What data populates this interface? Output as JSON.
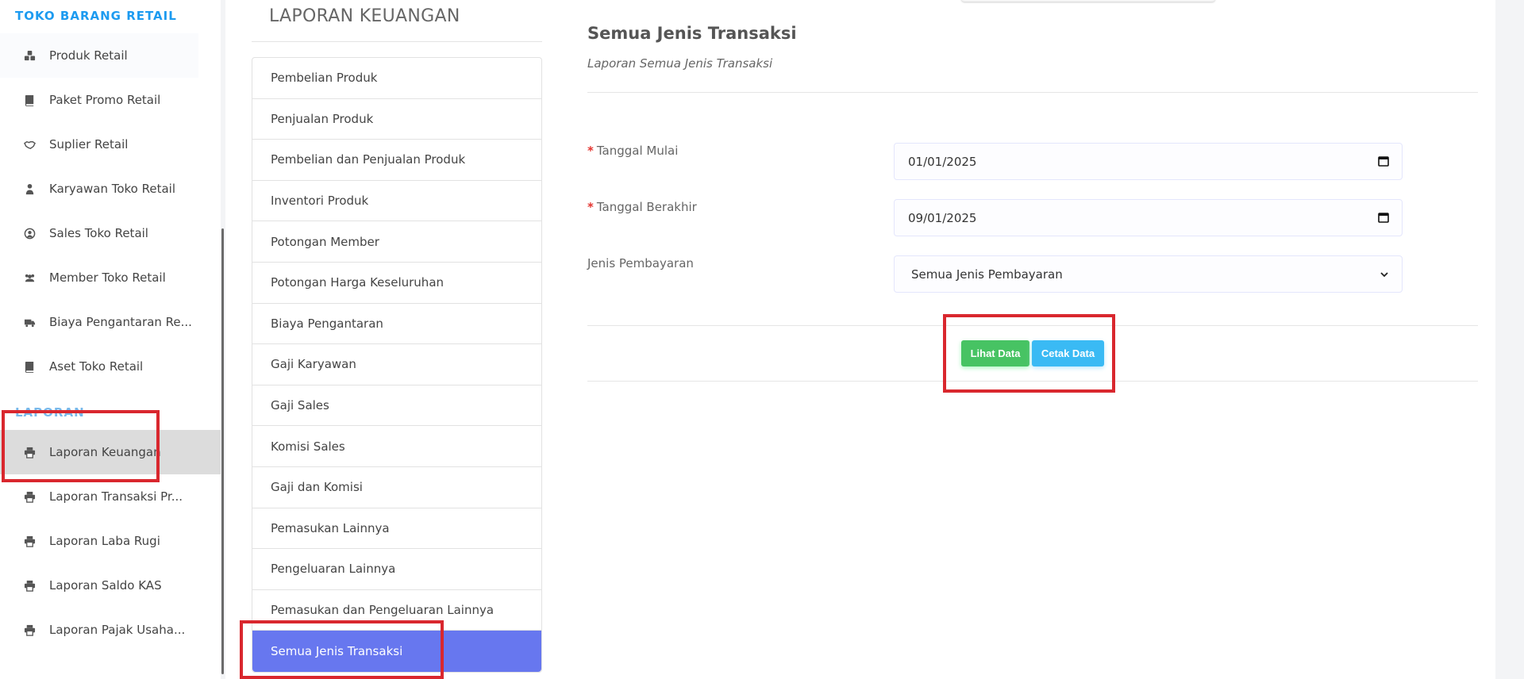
{
  "sidebar": {
    "section_store": "TOKO BARANG RETAIL",
    "items": [
      {
        "label": "Produk Retail",
        "icon": "boxes-icon"
      },
      {
        "label": "Paket Promo Retail",
        "icon": "book-icon"
      },
      {
        "label": "Suplier Retail",
        "icon": "handshake-icon"
      },
      {
        "label": "Karyawan Toko Retail",
        "icon": "user-tie-icon"
      },
      {
        "label": "Sales Toko Retail",
        "icon": "user-circle-icon"
      },
      {
        "label": "Member Toko Retail",
        "icon": "users-icon"
      },
      {
        "label": "Biaya Pengantaran Re...",
        "icon": "truck-icon"
      },
      {
        "label": "Aset Toko Retail",
        "icon": "book-icon"
      }
    ],
    "section_report": "LAPORAN",
    "report_items": [
      {
        "label": "Laporan Keuangan",
        "icon": "print-icon"
      },
      {
        "label": "Laporan Transaksi Pr...",
        "icon": "print-icon"
      },
      {
        "label": "Laporan Laba Rugi",
        "icon": "print-icon"
      },
      {
        "label": "Laporan Saldo KAS",
        "icon": "print-icon"
      },
      {
        "label": "Laporan Pajak Usaha...",
        "icon": "print-icon"
      }
    ]
  },
  "report_menu": {
    "title": "LAPORAN KEUANGAN",
    "items": [
      "Pembelian Produk",
      "Penjualan Produk",
      "Pembelian dan Penjualan Produk",
      "Inventori Produk",
      "Potongan Member",
      "Potongan Harga Keseluruhan",
      "Biaya Pengantaran",
      "Gaji Karyawan",
      "Gaji Sales",
      "Komisi Sales",
      "Gaji dan Komisi",
      "Pemasukan Lainnya",
      "Pengeluaran Lainnya",
      "Pemasukan dan Pengeluaran Lainnya",
      "Semua Jenis Transaksi"
    ]
  },
  "form": {
    "heading": "Semua Jenis Transaksi",
    "subheading": "Laporan Semua Jenis Transaksi",
    "required_mark": "*",
    "start_label": "Tanggal Mulai",
    "start_value": "01/01/2025",
    "end_label": "Tanggal Berakhir",
    "end_value": "09/01/2025",
    "payment_label": "Jenis Pembayaran",
    "payment_value": "Semua Jenis Pembayaran",
    "view_button": "Lihat Data",
    "print_button": "Cetak Data"
  },
  "colors": {
    "accent": "#6777ef",
    "sidebar_heading": "#1d9bf0",
    "view_button": "#47c363",
    "print_button": "#3abaf4",
    "annotation": "#d9272e"
  }
}
